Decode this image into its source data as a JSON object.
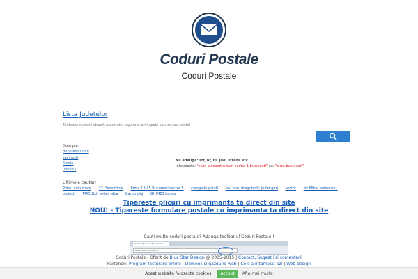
{
  "brand": {
    "name": "Coduri Postale"
  },
  "subtitle": "Coduri Postale",
  "search": {
    "lista_link": "Lista Judetelor",
    "hint": "Tasteaza numele strazii, orase etc. separate prin spatii sau un cod postal",
    "placeholder": ""
  },
  "exemple": {
    "label": "Exemple:",
    "items": [
      "Bucuresti unirii",
      "savinesti",
      "Sinaia",
      "030833"
    ]
  },
  "tips": {
    "nu_adauga": "Nu adauga: str, nr, bl, jud, strada etc..",
    "inlocuieste_prefix": "Inlocuieste: ",
    "inlocuieste_bad": "\"cuza alexandru ioan sector 1 bucuresti\"",
    "inlocuieste_mid": " cu: ",
    "inlocuieste_good": "\"cuza bucuresti\""
  },
  "ultimele": {
    "label": "Ultimele cautari",
    "items": [
      "Potau satu mare",
      "22 Decembrie",
      "firma 13-15 Bucuresti sector 5",
      "caragiale galati",
      "iasi nou, dragutesti, judet gorj",
      "sector",
      "str Mihai eminescu,",
      "ploiesti",
      "MACULUI sebes alba",
      "Barbu cluj",
      "GHIMES bacau"
    ]
  },
  "promos": {
    "line1": "Tipareste plicuri cu imprimanta ta direct din site",
    "line2": "NOU! - Tipareste formulare postale cu imprimanta ta direct din site"
  },
  "toolbar": {
    "question": "Cauti multe coduri postale? Adauga toolbar-ul Coduri Postale !",
    "tab_label": "Coduri Postale - Bucuresti...",
    "addr_label": "www.coduri-postale.ro"
  },
  "footer": {
    "prefix": "Coduri Postale - Oferit de ",
    "blue_star": "Blue Star Design",
    "years": " @ 2005-2015 | ",
    "contact": "Contact, Sugestii si comentarii",
    "parteneri_label": "Parteneri: ",
    "p1": "Program facturare online",
    "p2": "Domenii si gazduire web",
    "p3": "Ce s-a intamplat azi",
    "p4": "Web design"
  },
  "cookie": {
    "text": "Acest website foloseste cookies.",
    "accept": "Accept",
    "more": "Afla mai multe"
  },
  "colors": {
    "accent": "#2f7fd0",
    "brand": "#23364f",
    "accept": "#5cb85c",
    "warn": "#dd2222"
  }
}
